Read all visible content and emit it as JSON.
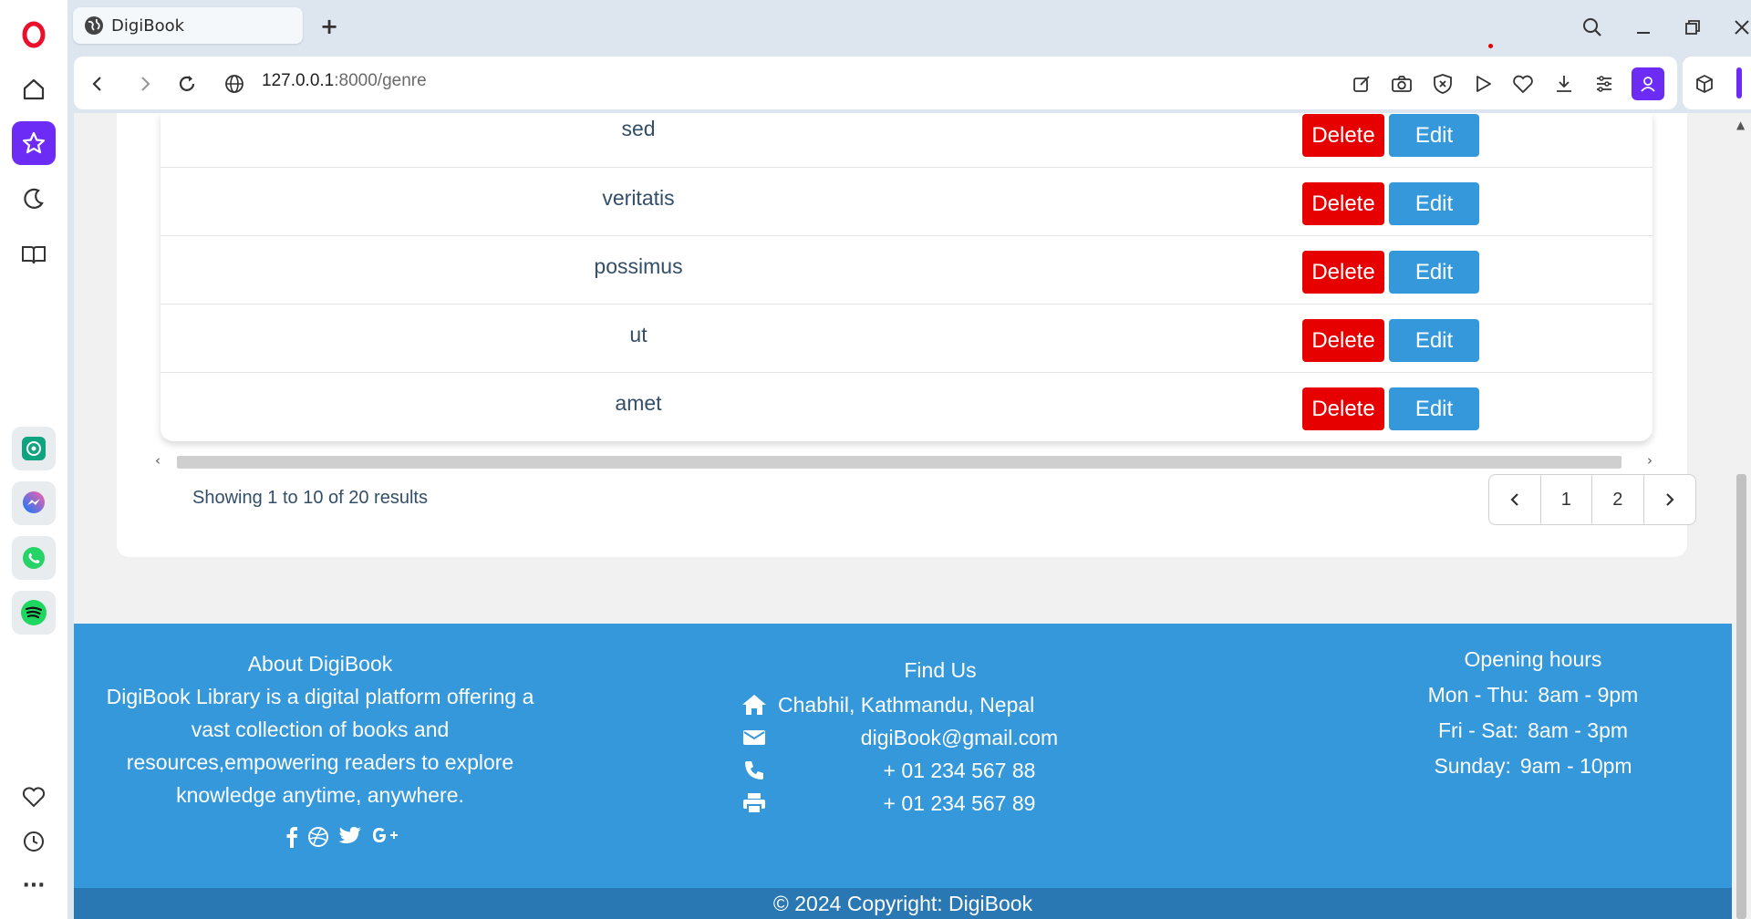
{
  "browser": {
    "tab_title": "DigiBook",
    "new_tab_symbol": "+",
    "url_host": "127.0.0.1",
    "url_path": ":8000/genre"
  },
  "table": {
    "rows": [
      {
        "genre": "sed",
        "delete": "Delete",
        "edit": "Edit"
      },
      {
        "genre": "veritatis",
        "delete": "Delete",
        "edit": "Edit"
      },
      {
        "genre": "possimus",
        "delete": "Delete",
        "edit": "Edit"
      },
      {
        "genre": "ut",
        "delete": "Delete",
        "edit": "Edit"
      },
      {
        "genre": "amet",
        "delete": "Delete",
        "edit": "Edit"
      }
    ]
  },
  "pagination": {
    "summary": "Showing 1 to 10 of 20 results",
    "pages": [
      "1",
      "2"
    ]
  },
  "footer": {
    "about_title": "About DigiBook",
    "about_text": "DigiBook Library is a digital platform offering a vast collection of books and resources,empowering readers to explore knowledge anytime, anywhere.",
    "find_title": "Find Us",
    "address": "Chabhil, Kathmandu, Nepal",
    "email": "digiBook@gmail.com",
    "phone": "+ 01 234 567 88",
    "fax": "+ 01 234 567 89",
    "hours_title": "Opening hours",
    "hours": [
      {
        "days": "Mon - Thu:",
        "time": "8am - 9pm"
      },
      {
        "days": "Fri - Sat:",
        "time": "8am - 3pm"
      },
      {
        "days": "Sunday:",
        "time": "9am - 10pm"
      }
    ],
    "copyright": "© 2024 Copyright: DigiBook"
  },
  "colors": {
    "delete": "#e60000",
    "edit": "#3498db",
    "footer": "#3498db",
    "copyright_bar": "#2a78b3",
    "opera_accent": "#6c2cf5"
  }
}
